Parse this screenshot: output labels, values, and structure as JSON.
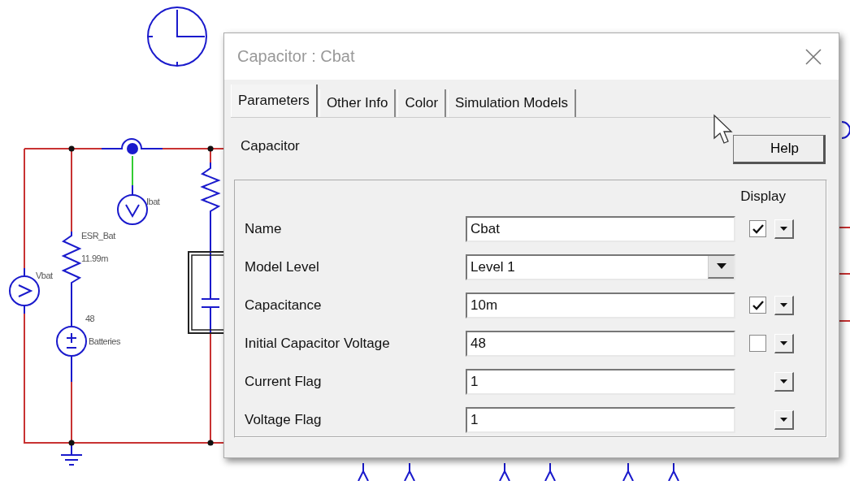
{
  "schematic": {
    "labels": [
      {
        "text": "Ibat"
      },
      {
        "text": "ESR_Bat"
      },
      {
        "text": "11.99m"
      },
      {
        "text": "Vbat"
      },
      {
        "text": "48"
      },
      {
        "text": "Batteries"
      }
    ]
  },
  "dialog": {
    "title": "Capacitor : Cbat",
    "tabs": [
      {
        "label": "Parameters",
        "selected": true
      },
      {
        "label": "Other Info",
        "selected": false
      },
      {
        "label": "Color",
        "selected": false
      },
      {
        "label": "Simulation Models",
        "selected": false
      }
    ],
    "section_title": "Capacitor",
    "help_button": "Help",
    "display_header": "Display",
    "params": [
      {
        "label": "Name",
        "kind": "text",
        "value": "Cbat",
        "display": true
      },
      {
        "label": "Model Level",
        "kind": "dropdown",
        "value": "Level 1"
      },
      {
        "label": "Capacitance",
        "kind": "text",
        "value": "10m",
        "display": true
      },
      {
        "label": "Initial Capacitor Voltage",
        "kind": "text",
        "value": "48",
        "display": false
      },
      {
        "label": "Current Flag",
        "kind": "text",
        "value": "1"
      },
      {
        "label": "Voltage Flag",
        "kind": "text",
        "value": "1"
      }
    ]
  }
}
